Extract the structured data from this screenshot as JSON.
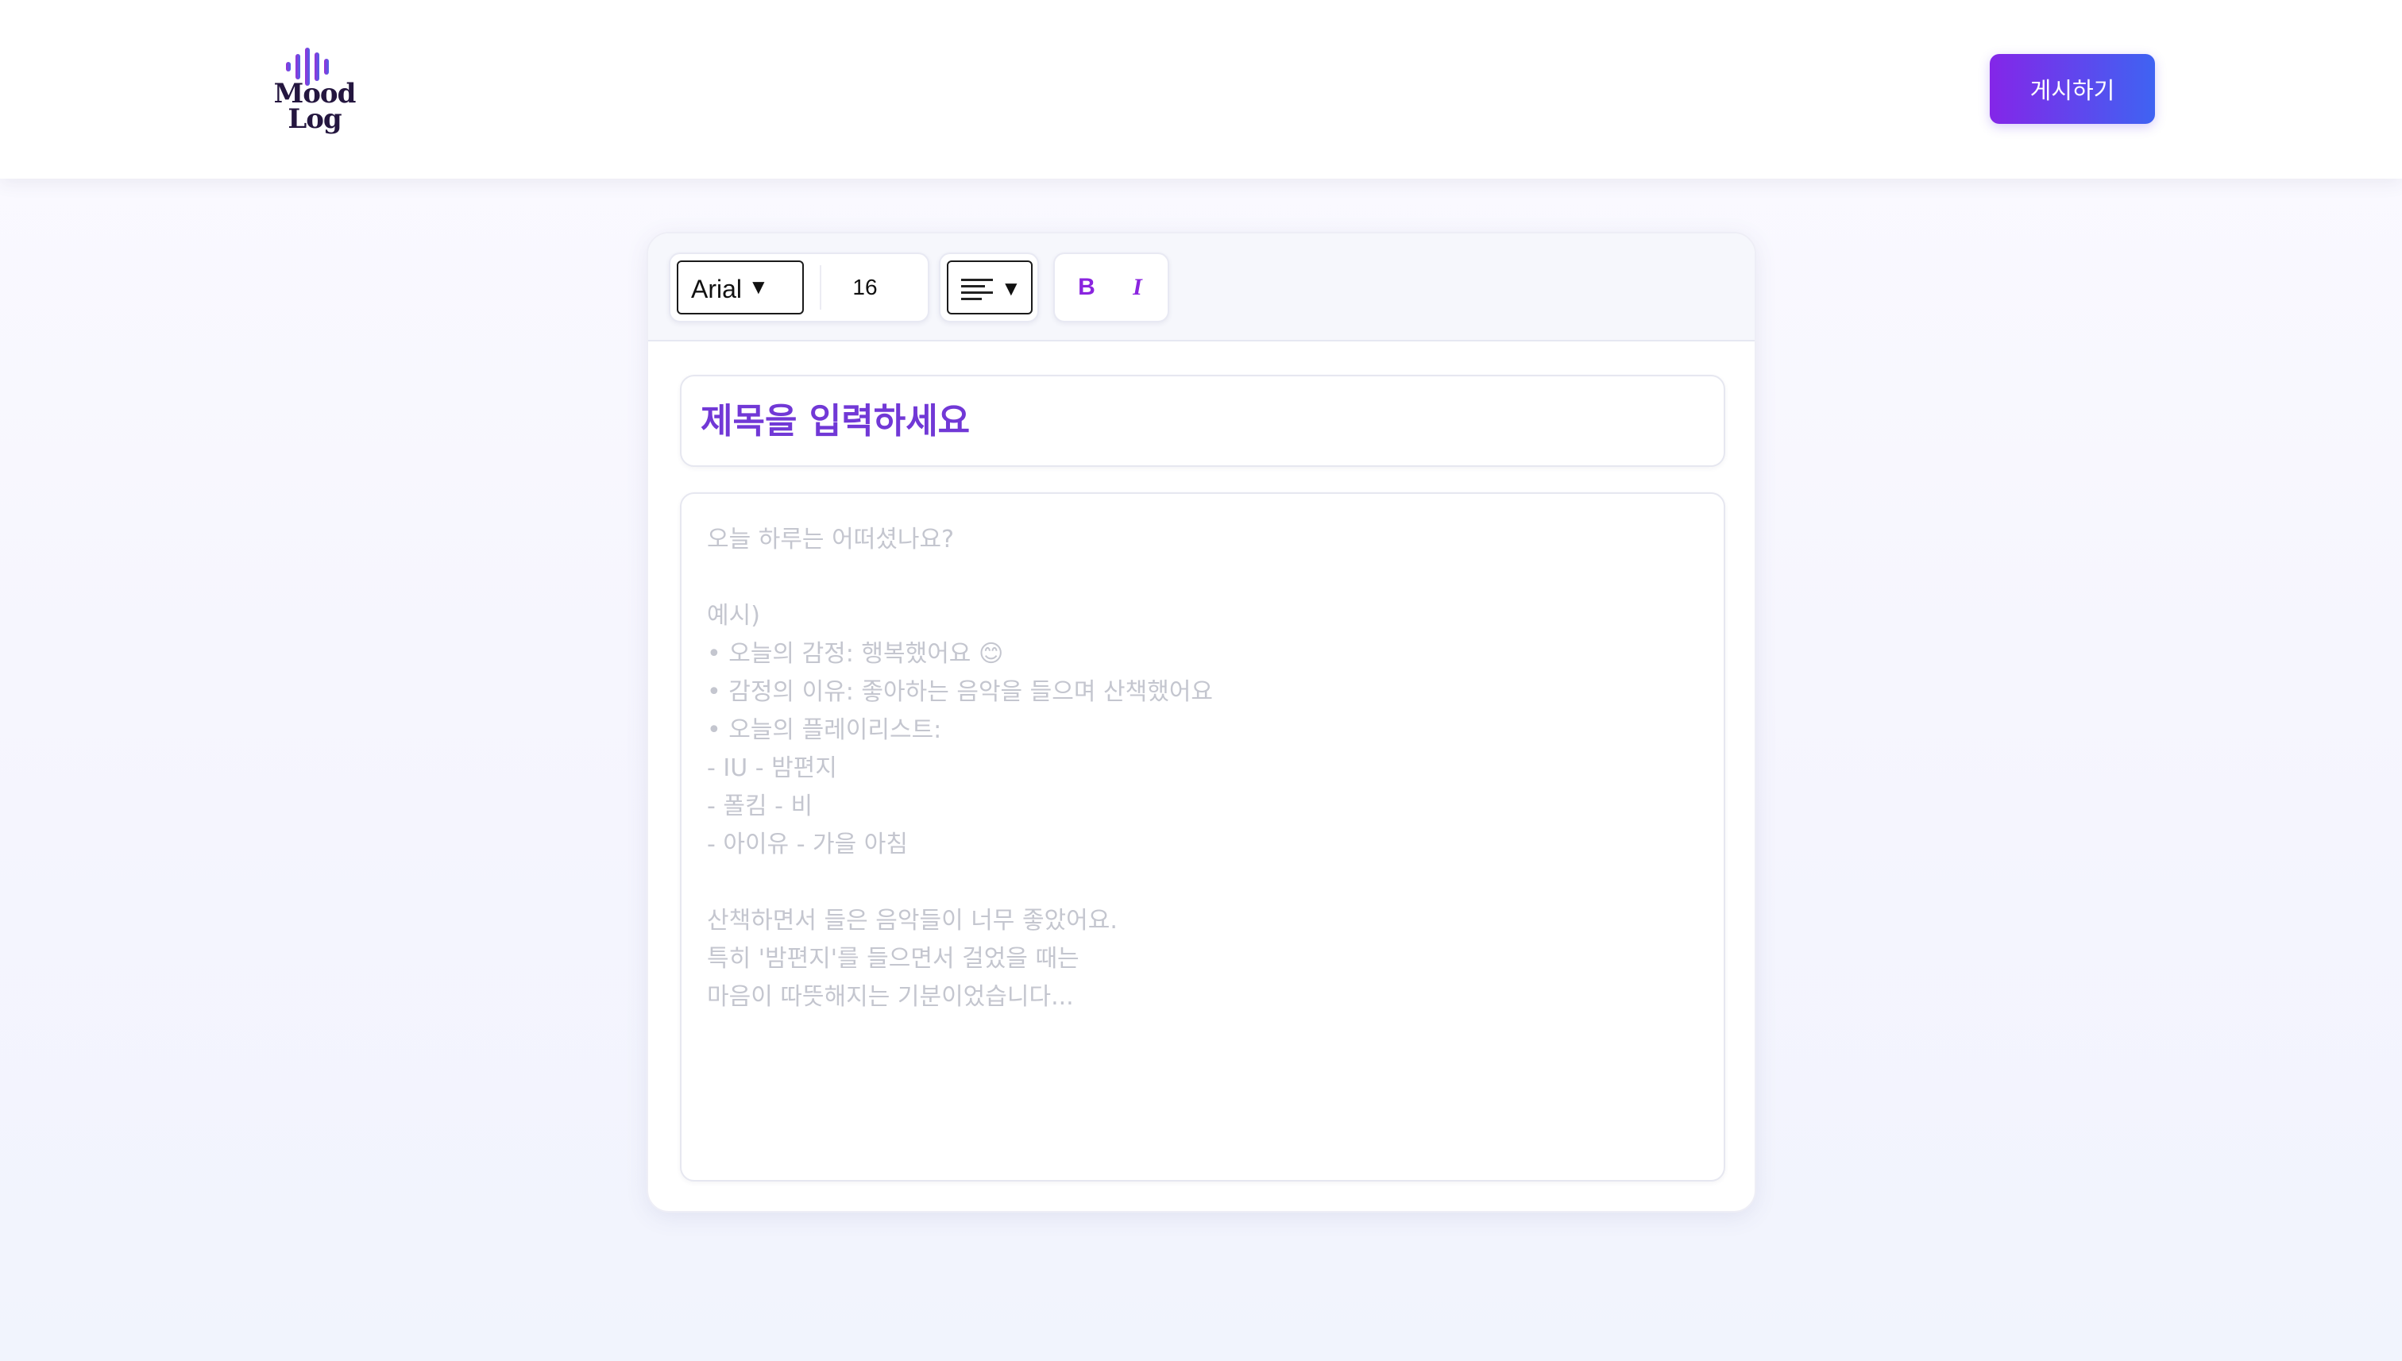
{
  "header": {
    "logo_line1": "Mood",
    "logo_line2": "Log",
    "publish_label": "게시하기",
    "colors": {
      "brand_start": "#8426e8",
      "brand_end": "#3f63f2",
      "logo_text": "#24163f"
    }
  },
  "toolbar": {
    "font_family_value": "Arial",
    "font_size_value": "16",
    "caret_glyph": "▼",
    "align_icon": "align-left-icon",
    "bold_label": "B",
    "italic_label": "I"
  },
  "editor": {
    "title_placeholder": "제목을 입력하세요",
    "body_placeholder": "오늘 하루는 어떠셨나요?\n\n예시)\n• 오늘의 감정: 행복했어요 😊\n• 감정의 이유: 좋아하는 음악을 들으며 산책했어요\n• 오늘의 플레이리스트:\n- IU - 밤편지\n- 폴킴 - 비\n- 아이유 - 가을 아침\n\n산책하면서 들은 음악들이 너무 좋았어요.\n특히 '밤편지'를 들으면서 걸었을 때는\n마음이 따뜻해지는 기분이었습니다...",
    "colors": {
      "title_placeholder": "#7138d6",
      "body_placeholder": "#c4c6cf",
      "format_buttons": "#8a24df"
    }
  }
}
